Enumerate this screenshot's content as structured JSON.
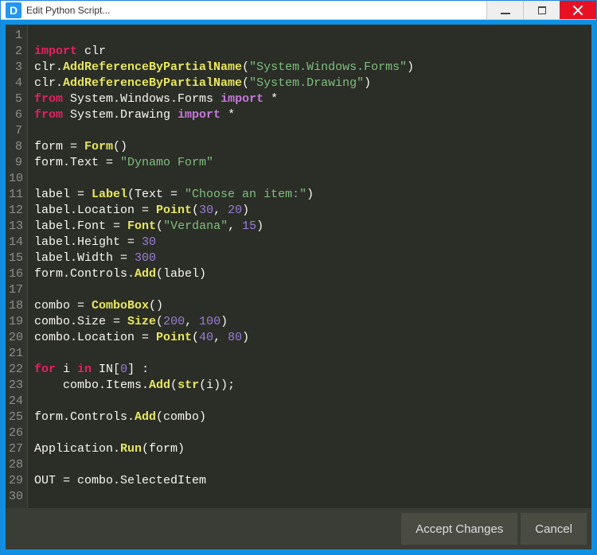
{
  "window": {
    "title": "Edit Python Script...",
    "app_initial": "D"
  },
  "footer": {
    "accept": "Accept Changes",
    "cancel": "Cancel"
  },
  "editor": {
    "line_count": 30,
    "tokens": [
      [],
      [
        [
          "kw",
          "import"
        ],
        [
          "op",
          " clr"
        ]
      ],
      [
        [
          "op",
          "clr."
        ],
        [
          "fn",
          "AddReferenceByPartialName"
        ],
        [
          "op",
          "("
        ],
        [
          "str",
          "\"System.Windows.Forms\""
        ],
        [
          "op",
          ")"
        ]
      ],
      [
        [
          "op",
          "clr."
        ],
        [
          "fn",
          "AddReferenceByPartialName"
        ],
        [
          "op",
          "("
        ],
        [
          "str",
          "\"System.Drawing\""
        ],
        [
          "op",
          ")"
        ]
      ],
      [
        [
          "kw",
          "from"
        ],
        [
          "op",
          " System.Windows.Forms "
        ],
        [
          "kw2",
          "import"
        ],
        [
          "op",
          " *"
        ]
      ],
      [
        [
          "kw",
          "from"
        ],
        [
          "op",
          " System.Drawing "
        ],
        [
          "kw2",
          "import"
        ],
        [
          "op",
          " *"
        ]
      ],
      [],
      [
        [
          "op",
          "form = "
        ],
        [
          "fn",
          "Form"
        ],
        [
          "op",
          "()"
        ]
      ],
      [
        [
          "op",
          "form.Text = "
        ],
        [
          "str",
          "\"Dynamo Form\""
        ]
      ],
      [],
      [
        [
          "op",
          "label = "
        ],
        [
          "fn",
          "Label"
        ],
        [
          "op",
          "(Text = "
        ],
        [
          "str",
          "\"Choose an item:\""
        ],
        [
          "op",
          ")"
        ]
      ],
      [
        [
          "op",
          "label.Location = "
        ],
        [
          "fn",
          "Point"
        ],
        [
          "op",
          "("
        ],
        [
          "num",
          "30"
        ],
        [
          "op",
          ", "
        ],
        [
          "num",
          "20"
        ],
        [
          "op",
          ")"
        ]
      ],
      [
        [
          "op",
          "label.Font = "
        ],
        [
          "fn",
          "Font"
        ],
        [
          "op",
          "("
        ],
        [
          "str",
          "\"Verdana\""
        ],
        [
          "op",
          ", "
        ],
        [
          "num",
          "15"
        ],
        [
          "op",
          ")"
        ]
      ],
      [
        [
          "op",
          "label.Height = "
        ],
        [
          "num",
          "30"
        ]
      ],
      [
        [
          "op",
          "label.Width = "
        ],
        [
          "num",
          "300"
        ]
      ],
      [
        [
          "op",
          "form.Controls."
        ],
        [
          "fn",
          "Add"
        ],
        [
          "op",
          "(label)"
        ]
      ],
      [],
      [
        [
          "op",
          "combo = "
        ],
        [
          "fn",
          "ComboBox"
        ],
        [
          "op",
          "()"
        ]
      ],
      [
        [
          "op",
          "combo.Size = "
        ],
        [
          "fn",
          "Size"
        ],
        [
          "op",
          "("
        ],
        [
          "num",
          "200"
        ],
        [
          "op",
          ", "
        ],
        [
          "num",
          "100"
        ],
        [
          "op",
          ")"
        ]
      ],
      [
        [
          "op",
          "combo.Location = "
        ],
        [
          "fn",
          "Point"
        ],
        [
          "op",
          "("
        ],
        [
          "num",
          "40"
        ],
        [
          "op",
          ", "
        ],
        [
          "num",
          "80"
        ],
        [
          "op",
          ")"
        ]
      ],
      [],
      [
        [
          "kw",
          "for"
        ],
        [
          "op",
          " i "
        ],
        [
          "kw",
          "in"
        ],
        [
          "op",
          " IN["
        ],
        [
          "num",
          "0"
        ],
        [
          "op",
          "] :"
        ]
      ],
      [
        [
          "op",
          "    combo.Items."
        ],
        [
          "fn",
          "Add"
        ],
        [
          "op",
          "("
        ],
        [
          "fn",
          "str"
        ],
        [
          "op",
          "(i));"
        ]
      ],
      [],
      [
        [
          "op",
          "form.Controls."
        ],
        [
          "fn",
          "Add"
        ],
        [
          "op",
          "(combo)"
        ]
      ],
      [],
      [
        [
          "op",
          "Application."
        ],
        [
          "fn",
          "Run"
        ],
        [
          "op",
          "(form)"
        ]
      ],
      [],
      [
        [
          "op",
          "OUT = combo.SelectedItem"
        ]
      ],
      []
    ]
  }
}
